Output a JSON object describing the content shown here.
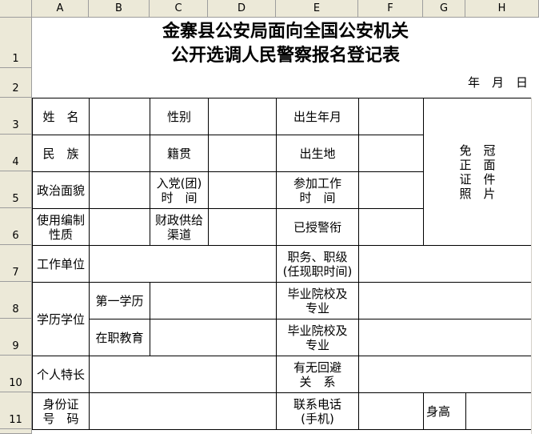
{
  "columns": [
    "A",
    "B",
    "C",
    "D",
    "E",
    "F",
    "G",
    "H"
  ],
  "rows": [
    "1",
    "2",
    "3",
    "4",
    "5",
    "6",
    "7",
    "8",
    "9",
    "10",
    "11"
  ],
  "form": {
    "title_line1": "金寨县公安局面向全国公安机关",
    "title_line2": "公开选调人民警察报名登记表",
    "date": "年　月　日",
    "name": "姓　名",
    "gender": "性别",
    "birth": "出生年月",
    "ethnicity": "民　族",
    "native": "籍贯",
    "birthplace": "出生地",
    "photo": [
      "免　冠",
      "正　面",
      "证　件",
      "照　片"
    ],
    "political": "政治面貌",
    "party_line1": "入党(团)",
    "party_line2": "时　间",
    "work_start_line1": "参加工作",
    "work_start_line2": "时　间",
    "staffing_line1": "使用编制",
    "staffing_line2": "性质",
    "finance_line1": "财政供给",
    "finance_line2": "渠道",
    "rank": "已授警衔",
    "employer": "工作单位",
    "position_line1": "职务、职级",
    "position_line2": "(任现职时间)",
    "education": "学历学位",
    "first_edu": "第一学历",
    "school1_line1": "毕业院校及",
    "school1_line2": "专业",
    "inservice_edu": "在职教育",
    "school2_line1": "毕业院校及",
    "school2_line2": "专业",
    "specialty": "个人特长",
    "avoid_line1": "有无回避",
    "avoid_line2": "关　系",
    "idcard_line1": "身份证",
    "idcard_line2": "号　码",
    "phone_line1": "联系电话",
    "phone_line2": "(手机)",
    "height": "身高"
  }
}
